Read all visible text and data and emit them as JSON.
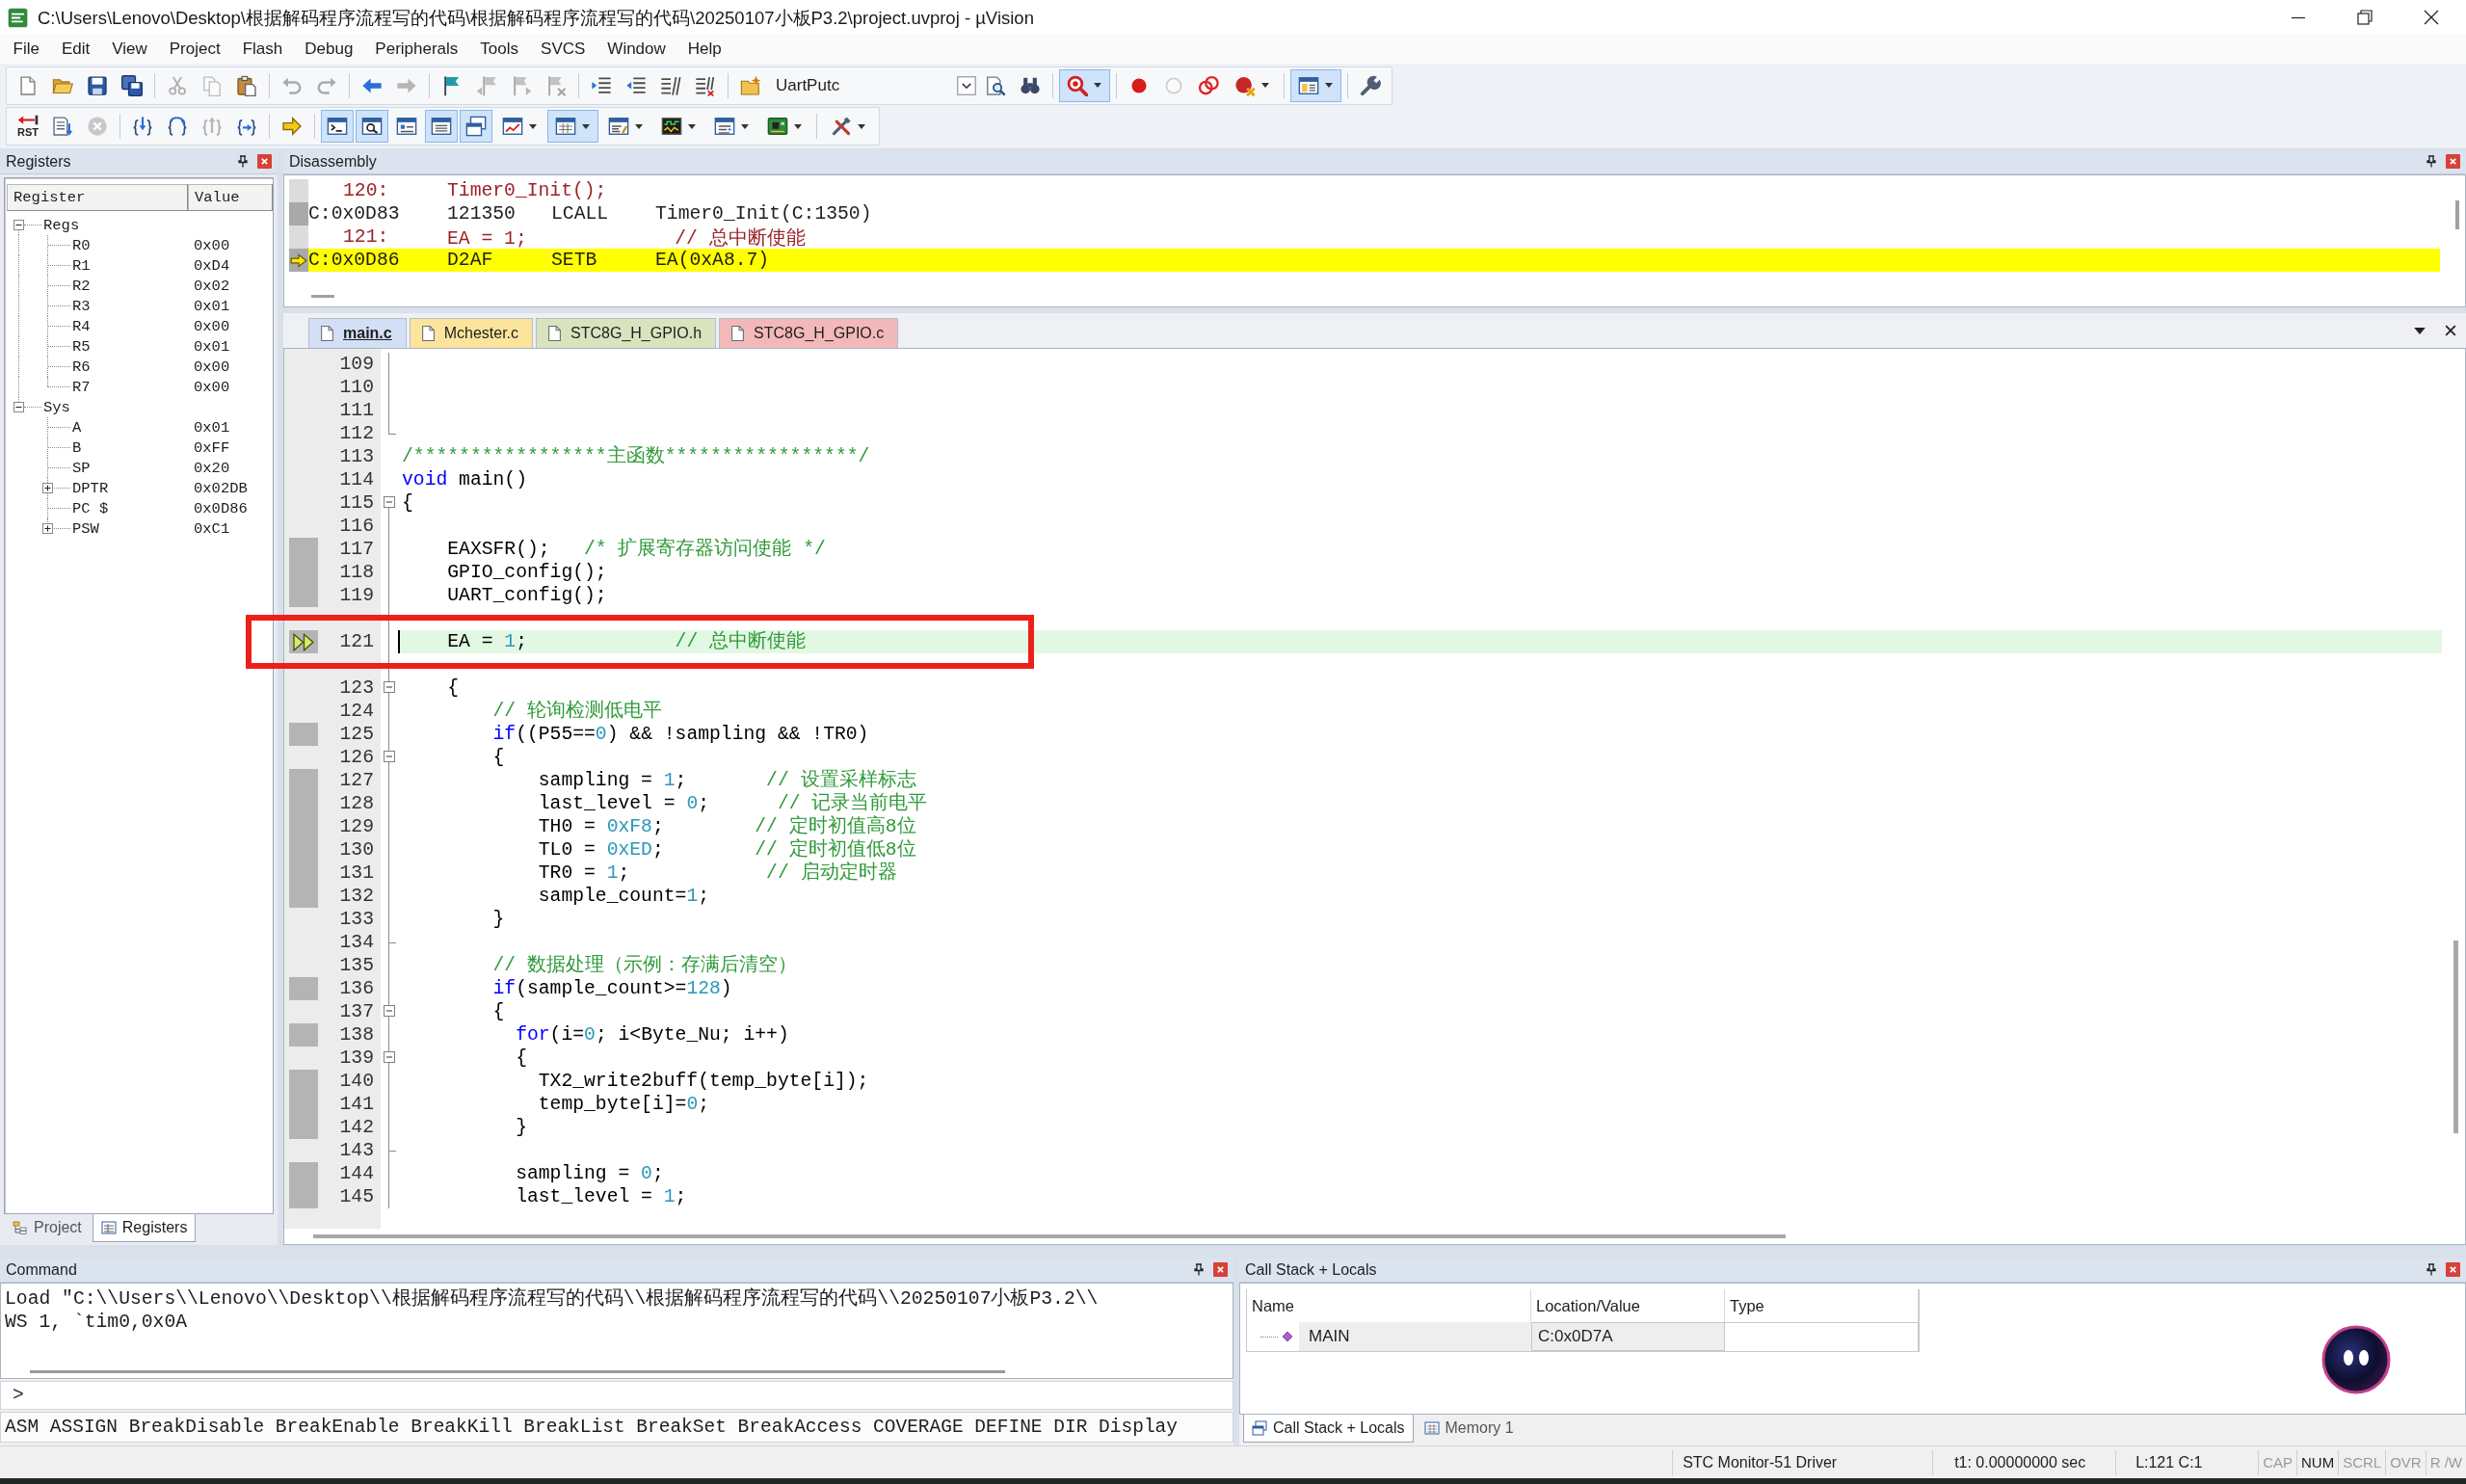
{
  "window": {
    "title": "C:\\Users\\Lenovo\\Desktop\\根据解码程序流程写的代码\\根据解码程序流程写的代码\\20250107小板P3.2\\project.uvproj - µVision"
  },
  "menu": [
    "File",
    "Edit",
    "View",
    "Project",
    "Flash",
    "Debug",
    "Peripherals",
    "Tools",
    "SVCS",
    "Window",
    "Help"
  ],
  "toolbar_1": [
    {
      "kind": "button",
      "on": false,
      "disabled": false
    },
    {
      "kind": "button",
      "on": false,
      "disabled": false
    },
    {
      "kind": "button",
      "on": false,
      "disabled": false
    },
    {
      "kind": "button",
      "on": false,
      "disabled": false
    },
    {
      "kind": "separator"
    },
    {
      "kind": "button",
      "on": false,
      "disabled": true
    },
    {
      "kind": "button",
      "on": false,
      "disabled": true
    },
    {
      "kind": "button",
      "on": false,
      "disabled": false
    },
    {
      "kind": "separator"
    },
    {
      "kind": "button",
      "on": false,
      "disabled": true
    },
    {
      "kind": "button",
      "on": false,
      "disabled": true
    },
    {
      "kind": "separator"
    },
    {
      "kind": "button",
      "on": false,
      "disabled": false
    },
    {
      "kind": "button",
      "on": false,
      "disabled": true
    },
    {
      "kind": "separator"
    },
    {
      "kind": "button",
      "on": false,
      "disabled": false
    },
    {
      "kind": "button",
      "on": false,
      "disabled": true
    },
    {
      "kind": "button",
      "on": false,
      "disabled": true
    },
    {
      "kind": "button",
      "on": false,
      "disabled": true
    },
    {
      "kind": "separator"
    },
    {
      "kind": "button",
      "on": false,
      "disabled": false
    },
    {
      "kind": "button",
      "on": false,
      "disabled": false
    },
    {
      "kind": "button",
      "on": false,
      "disabled": false
    },
    {
      "kind": "button",
      "on": false,
      "disabled": false
    },
    {
      "kind": "separator"
    },
    {
      "kind": "button",
      "on": false,
      "disabled": false
    },
    {
      "kind": "combo",
      "value": "UartPutc"
    },
    {
      "kind": "button",
      "on": false,
      "disabled": false
    },
    {
      "kind": "button",
      "on": false,
      "disabled": false
    },
    {
      "kind": "separator"
    },
    {
      "kind": "split",
      "on": true,
      "disabled": false
    },
    {
      "kind": "separator"
    },
    {
      "kind": "button",
      "on": false,
      "disabled": false
    },
    {
      "kind": "button",
      "on": false,
      "disabled": true
    },
    {
      "kind": "button",
      "on": false,
      "disabled": false
    },
    {
      "kind": "split",
      "on": false,
      "disabled": false
    },
    {
      "kind": "separator"
    },
    {
      "kind": "split",
      "on": true,
      "disabled": false
    },
    {
      "kind": "separator"
    },
    {
      "kind": "button",
      "on": false,
      "disabled": false
    }
  ],
  "toolbar_2": [
    {
      "kind": "button",
      "label": "RST",
      "on": false,
      "disabled": false
    },
    {
      "kind": "button",
      "on": false,
      "disabled": false
    },
    {
      "kind": "button",
      "on": false,
      "disabled": true
    },
    {
      "kind": "separator"
    },
    {
      "kind": "button",
      "on": false,
      "disabled": false
    },
    {
      "kind": "button",
      "on": false,
      "disabled": false
    },
    {
      "kind": "button",
      "on": false,
      "disabled": true
    },
    {
      "kind": "button",
      "on": false,
      "disabled": false
    },
    {
      "kind": "separator"
    },
    {
      "kind": "button",
      "on": false,
      "disabled": false
    },
    {
      "kind": "separator"
    },
    {
      "kind": "button",
      "on": true,
      "disabled": false
    },
    {
      "kind": "button",
      "on": true,
      "disabled": false
    },
    {
      "kind": "button",
      "on": false,
      "disabled": false
    },
    {
      "kind": "button",
      "on": true,
      "disabled": false
    },
    {
      "kind": "button",
      "on": true,
      "disabled": false
    },
    {
      "kind": "split",
      "on": false,
      "disabled": false
    },
    {
      "kind": "split",
      "on": true,
      "disabled": false
    },
    {
      "kind": "split",
      "on": false,
      "disabled": false
    },
    {
      "kind": "split",
      "on": false,
      "disabled": false
    },
    {
      "kind": "split",
      "on": false,
      "disabled": false
    },
    {
      "kind": "split",
      "on": false,
      "disabled": false
    },
    {
      "kind": "separator"
    },
    {
      "kind": "split",
      "on": false,
      "disabled": false
    }
  ],
  "registers_panel": {
    "title": "Registers",
    "columns": [
      "Register",
      "Value"
    ],
    "tree": [
      {
        "name": "Regs",
        "expanded": true,
        "children": [
          {
            "name": "R0",
            "value": "0x00"
          },
          {
            "name": "R1",
            "value": "0xD4"
          },
          {
            "name": "R2",
            "value": "0x02"
          },
          {
            "name": "R3",
            "value": "0x01"
          },
          {
            "name": "R4",
            "value": "0x00"
          },
          {
            "name": "R5",
            "value": "0x01"
          },
          {
            "name": "R6",
            "value": "0x00"
          },
          {
            "name": "R7",
            "value": "0x00"
          }
        ]
      },
      {
        "name": "Sys",
        "expanded": true,
        "children": [
          {
            "name": "A",
            "value": "0x01"
          },
          {
            "name": "B",
            "value": "0xFF"
          },
          {
            "name": "SP",
            "value": "0x20"
          },
          {
            "name": "DPTR",
            "value": "0x02DB",
            "expanded": false
          },
          {
            "name": "PC $",
            "value": "0x0D86"
          },
          {
            "name": "PSW",
            "value": "0xC1",
            "expanded": false
          }
        ]
      }
    ],
    "tabs": [
      {
        "label": "Project",
        "selected": false
      },
      {
        "label": "Registers",
        "selected": true
      }
    ]
  },
  "disassembly": {
    "title": "Disassembly",
    "lines": [
      {
        "kind": "source",
        "line": "120:",
        "code": "Timer0_Init();",
        "current": false
      },
      {
        "kind": "asm",
        "address": "C:0x0D83",
        "opcode": "121350",
        "mnemonic": "LCALL",
        "operand": "Timer0_Init(C:1350)",
        "current": false
      },
      {
        "kind": "source",
        "line": "121:",
        "code": "EA = 1;             // 总中断使能",
        "current": false
      },
      {
        "kind": "asm",
        "address": "C:0x0D86",
        "opcode": "D2AF",
        "mnemonic": "SETB",
        "operand": "EA(0xA8.7)",
        "current": true
      }
    ]
  },
  "editor_tabs": [
    {
      "label": "main.c",
      "selected": true,
      "color": "#d3dff5"
    },
    {
      "label": "Mchester.c",
      "selected": false,
      "color": "#fce49c"
    },
    {
      "label": "STC8G_H_GPIO.h",
      "selected": false,
      "color": "#d8e4be"
    },
    {
      "label": "STC8G_H_GPIO.c",
      "selected": false,
      "color": "#f3b8b9"
    }
  ],
  "editor": {
    "lines": [
      {
        "kind": "guide",
        "number": "109",
        "executable": false,
        "current": false,
        "framed": false
      },
      {
        "kind": "guide",
        "number": "110",
        "executable": false,
        "current": false,
        "framed": false
      },
      {
        "kind": "guide",
        "number": "111",
        "executable": false,
        "current": false,
        "framed": false
      },
      {
        "kind": "closer",
        "number": "112",
        "executable": false,
        "current": false,
        "framed": false
      },
      {
        "kind": "plain",
        "number": "113",
        "executable": false,
        "current": false,
        "framed": false,
        "tokens": [
          {
            "kind": "comment",
            "text": "/*****************主函数*****************/"
          }
        ]
      },
      {
        "kind": "plain",
        "number": "114",
        "executable": false,
        "current": false,
        "framed": false,
        "tokens": [
          {
            "kind": "keyword",
            "text": "void"
          },
          {
            "kind": "plain",
            "text": " main()"
          }
        ]
      },
      {
        "kind": "opener",
        "number": "115",
        "executable": false,
        "current": false,
        "framed": false,
        "tokens": [
          {
            "kind": "plain",
            "text": "{"
          }
        ]
      },
      {
        "kind": "guide",
        "number": "116",
        "executable": false,
        "current": false,
        "framed": false
      },
      {
        "kind": "guide",
        "number": "117",
        "executable": true,
        "current": false,
        "framed": false,
        "tokens": [
          {
            "kind": "plain",
            "text": "    EAXSFR();   "
          },
          {
            "kind": "comment",
            "text": "/* 扩展寄存器访问使能 */"
          }
        ]
      },
      {
        "kind": "guide",
        "number": "118",
        "executable": true,
        "current": false,
        "framed": false,
        "tokens": [
          {
            "kind": "plain",
            "text": "    GPIO_config();"
          }
        ]
      },
      {
        "kind": "guide",
        "number": "119",
        "executable": true,
        "current": false,
        "framed": false,
        "tokens": [
          {
            "kind": "plain",
            "text": "    UART_config();"
          }
        ]
      },
      {
        "kind": "guide",
        "number": "121",
        "executable": true,
        "current": true,
        "framed": true,
        "tokens": [
          {
            "kind": "plain",
            "text": "    EA = "
          },
          {
            "kind": "number",
            "text": "1"
          },
          {
            "kind": "plain",
            "text": ";             "
          },
          {
            "kind": "comment",
            "text": "// 总中断使能"
          }
        ]
      },
      {
        "kind": "inner-opener",
        "number": "123",
        "executable": false,
        "current": false,
        "framed": false,
        "tokens": [
          {
            "kind": "plain",
            "text": "    {"
          }
        ]
      },
      {
        "kind": "guide",
        "number": "124",
        "executable": false,
        "current": false,
        "framed": false,
        "tokens": [
          {
            "kind": "comment",
            "text": "        // 轮询检测低电平"
          }
        ]
      },
      {
        "kind": "guide",
        "number": "125",
        "executable": true,
        "current": false,
        "framed": false,
        "tokens": [
          {
            "kind": "keyword",
            "text": "        if"
          },
          {
            "kind": "plain",
            "text": "((P55=="
          },
          {
            "kind": "number",
            "text": "0"
          },
          {
            "kind": "plain",
            "text": ") && !sampling && !TR0)"
          }
        ]
      },
      {
        "kind": "inner-opener",
        "number": "126",
        "executable": false,
        "current": false,
        "framed": false,
        "tokens": [
          {
            "kind": "plain",
            "text": "        {"
          }
        ]
      },
      {
        "kind": "guide",
        "number": "127",
        "executable": true,
        "current": false,
        "framed": false,
        "tokens": [
          {
            "kind": "plain",
            "text": "            sampling = "
          },
          {
            "kind": "number",
            "text": "1"
          },
          {
            "kind": "plain",
            "text": ";       "
          },
          {
            "kind": "comment",
            "text": "// 设置采样标志"
          }
        ]
      },
      {
        "kind": "guide",
        "number": "128",
        "executable": true,
        "current": false,
        "framed": false,
        "tokens": [
          {
            "kind": "plain",
            "text": "            last_level = "
          },
          {
            "kind": "number",
            "text": "0"
          },
          {
            "kind": "plain",
            "text": ";      "
          },
          {
            "kind": "comment",
            "text": "// 记录当前电平"
          }
        ]
      },
      {
        "kind": "guide",
        "number": "129",
        "executable": true,
        "current": false,
        "framed": false,
        "tokens": [
          {
            "kind": "plain",
            "text": "            TH0 = "
          },
          {
            "kind": "number",
            "text": "0xF8"
          },
          {
            "kind": "plain",
            "text": ";        "
          },
          {
            "kind": "comment",
            "text": "// 定时初值高8位"
          }
        ]
      },
      {
        "kind": "guide",
        "number": "130",
        "executable": true,
        "current": false,
        "framed": false,
        "tokens": [
          {
            "kind": "plain",
            "text": "            TL0 = "
          },
          {
            "kind": "number",
            "text": "0xED"
          },
          {
            "kind": "plain",
            "text": ";        "
          },
          {
            "kind": "comment",
            "text": "// 定时初值低8位"
          }
        ]
      },
      {
        "kind": "guide",
        "number": "131",
        "executable": true,
        "current": false,
        "framed": false,
        "tokens": [
          {
            "kind": "plain",
            "text": "            TR0 = "
          },
          {
            "kind": "number",
            "text": "1"
          },
          {
            "kind": "plain",
            "text": ";            "
          },
          {
            "kind": "comment",
            "text": "// 启动定时器"
          }
        ]
      },
      {
        "kind": "guide",
        "number": "132",
        "executable": true,
        "current": false,
        "framed": false,
        "tokens": [
          {
            "kind": "plain",
            "text": "            sample_count="
          },
          {
            "kind": "number",
            "text": "1"
          },
          {
            "kind": "plain",
            "text": ";"
          }
        ]
      },
      {
        "kind": "guide",
        "number": "133",
        "executable": false,
        "current": false,
        "framed": false,
        "tokens": [
          {
            "kind": "plain",
            "text": "        }"
          }
        ]
      },
      {
        "kind": "inner-closer",
        "number": "134",
        "executable": false,
        "current": false,
        "framed": false
      },
      {
        "kind": "guide",
        "number": "135",
        "executable": false,
        "current": false,
        "framed": false,
        "tokens": [
          {
            "kind": "comment",
            "text": "        // 数据处理（示例：存满后清空）"
          }
        ]
      },
      {
        "kind": "guide",
        "number": "136",
        "executable": true,
        "current": false,
        "framed": false,
        "tokens": [
          {
            "kind": "keyword",
            "text": "        if"
          },
          {
            "kind": "plain",
            "text": "(sample_count>="
          },
          {
            "kind": "number",
            "text": "128"
          },
          {
            "kind": "plain",
            "text": ")"
          }
        ]
      },
      {
        "kind": "inner-opener",
        "number": "137",
        "executable": false,
        "current": false,
        "framed": false,
        "tokens": [
          {
            "kind": "plain",
            "text": "        {"
          }
        ]
      },
      {
        "kind": "guide",
        "number": "138",
        "executable": true,
        "current": false,
        "framed": false,
        "tokens": [
          {
            "kind": "keyword",
            "text": "          for"
          },
          {
            "kind": "plain",
            "text": "(i="
          },
          {
            "kind": "number",
            "text": "0"
          },
          {
            "kind": "plain",
            "text": "; i<Byte_Nu; i++)"
          }
        ]
      },
      {
        "kind": "inner-opener",
        "number": "139",
        "executable": false,
        "current": false,
        "framed": false,
        "tokens": [
          {
            "kind": "plain",
            "text": "          {"
          }
        ]
      },
      {
        "kind": "guide",
        "number": "140",
        "executable": true,
        "current": false,
        "framed": false,
        "tokens": [
          {
            "kind": "plain",
            "text": "            TX2_write2buff(temp_byte[i]);"
          }
        ]
      },
      {
        "kind": "guide",
        "number": "141",
        "executable": true,
        "current": false,
        "framed": false,
        "tokens": [
          {
            "kind": "plain",
            "text": "            temp_byte[i]="
          },
          {
            "kind": "number",
            "text": "0"
          },
          {
            "kind": "plain",
            "text": ";"
          }
        ]
      },
      {
        "kind": "guide",
        "number": "142",
        "executable": true,
        "current": false,
        "framed": false,
        "tokens": [
          {
            "kind": "plain",
            "text": "          }"
          }
        ]
      },
      {
        "kind": "inner-closer",
        "number": "143",
        "executable": false,
        "current": false,
        "framed": false
      },
      {
        "kind": "guide",
        "number": "144",
        "executable": true,
        "current": false,
        "framed": false,
        "tokens": [
          {
            "kind": "plain",
            "text": "          sampling = "
          },
          {
            "kind": "number",
            "text": "0"
          },
          {
            "kind": "plain",
            "text": ";"
          }
        ]
      },
      {
        "kind": "guide",
        "number": "145",
        "executable": true,
        "current": false,
        "framed": false,
        "tokens": [
          {
            "kind": "plain",
            "text": "          last_level = "
          },
          {
            "kind": "number",
            "text": "1"
          },
          {
            "kind": "plain",
            "text": ";"
          }
        ]
      }
    ]
  },
  "command": {
    "title": "Command",
    "output": [
      "Load \"C:\\\\Users\\\\Lenovo\\\\Desktop\\\\根据解码程序流程写的代码\\\\根据解码程序流程写的代码\\\\20250107小板P3.2\\\\",
      "WS 1, `tim0,0x0A"
    ],
    "prompt": ">",
    "hint": "ASM ASSIGN BreakDisable BreakEnable BreakKill BreakList BreakSet BreakAccess COVERAGE DEFINE DIR Display"
  },
  "call_stack": {
    "title": "Call Stack + Locals",
    "columns": [
      "Name",
      "Location/Value",
      "Type"
    ],
    "rows": [
      {
        "name": "MAIN",
        "location": "C:0x0D7A"
      }
    ],
    "tabs": [
      {
        "label": "Call Stack + Locals",
        "selected": true
      },
      {
        "label": "Memory 1",
        "selected": false
      }
    ]
  },
  "status_bar": {
    "driver": "STC Monitor-51 Driver",
    "time": "t1: 0.00000000 sec",
    "position": "L:121 C:1",
    "indicators": [
      {
        "label": "CAP",
        "on": false
      },
      {
        "label": "NUM",
        "on": true
      },
      {
        "label": "SCRL",
        "on": false
      },
      {
        "label": "OVR",
        "on": false
      },
      {
        "label": "R /W",
        "on": false
      }
    ]
  }
}
